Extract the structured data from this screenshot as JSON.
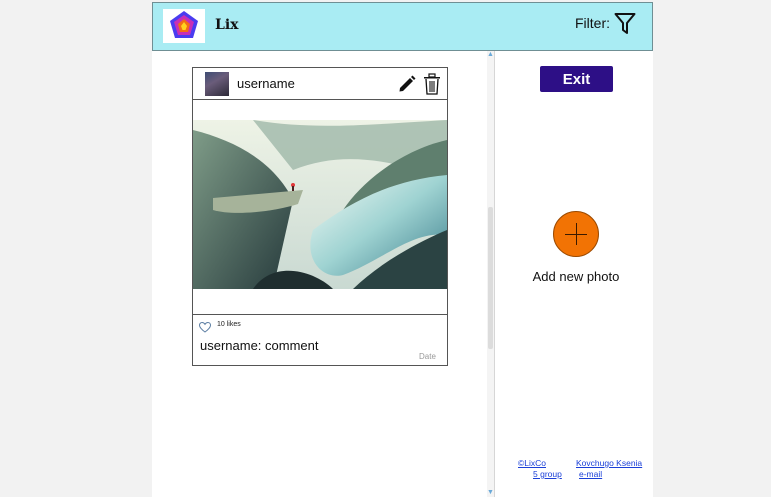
{
  "header": {
    "app_name": "Lix",
    "filter_label": "Filter:"
  },
  "post": {
    "username": "username",
    "likes": "10 likes",
    "comment": "username: comment",
    "date": "Date"
  },
  "sidebar": {
    "exit_label": "Exit",
    "add_photo_label": "Add new photo"
  },
  "footer": {
    "copyright": "©LixCo",
    "author": "Kovchugo Ksenia",
    "group": "5 group",
    "email": "e-mail"
  },
  "colors": {
    "header_bg": "#a9ecf3",
    "exit_button": "#2d0f86",
    "add_button": "#f27304",
    "link": "#1a3fd8"
  },
  "icons": [
    "lix-logo-icon",
    "filter-funnel-icon",
    "pencil-edit-icon",
    "trash-icon",
    "heart-icon",
    "plus-icon"
  ]
}
